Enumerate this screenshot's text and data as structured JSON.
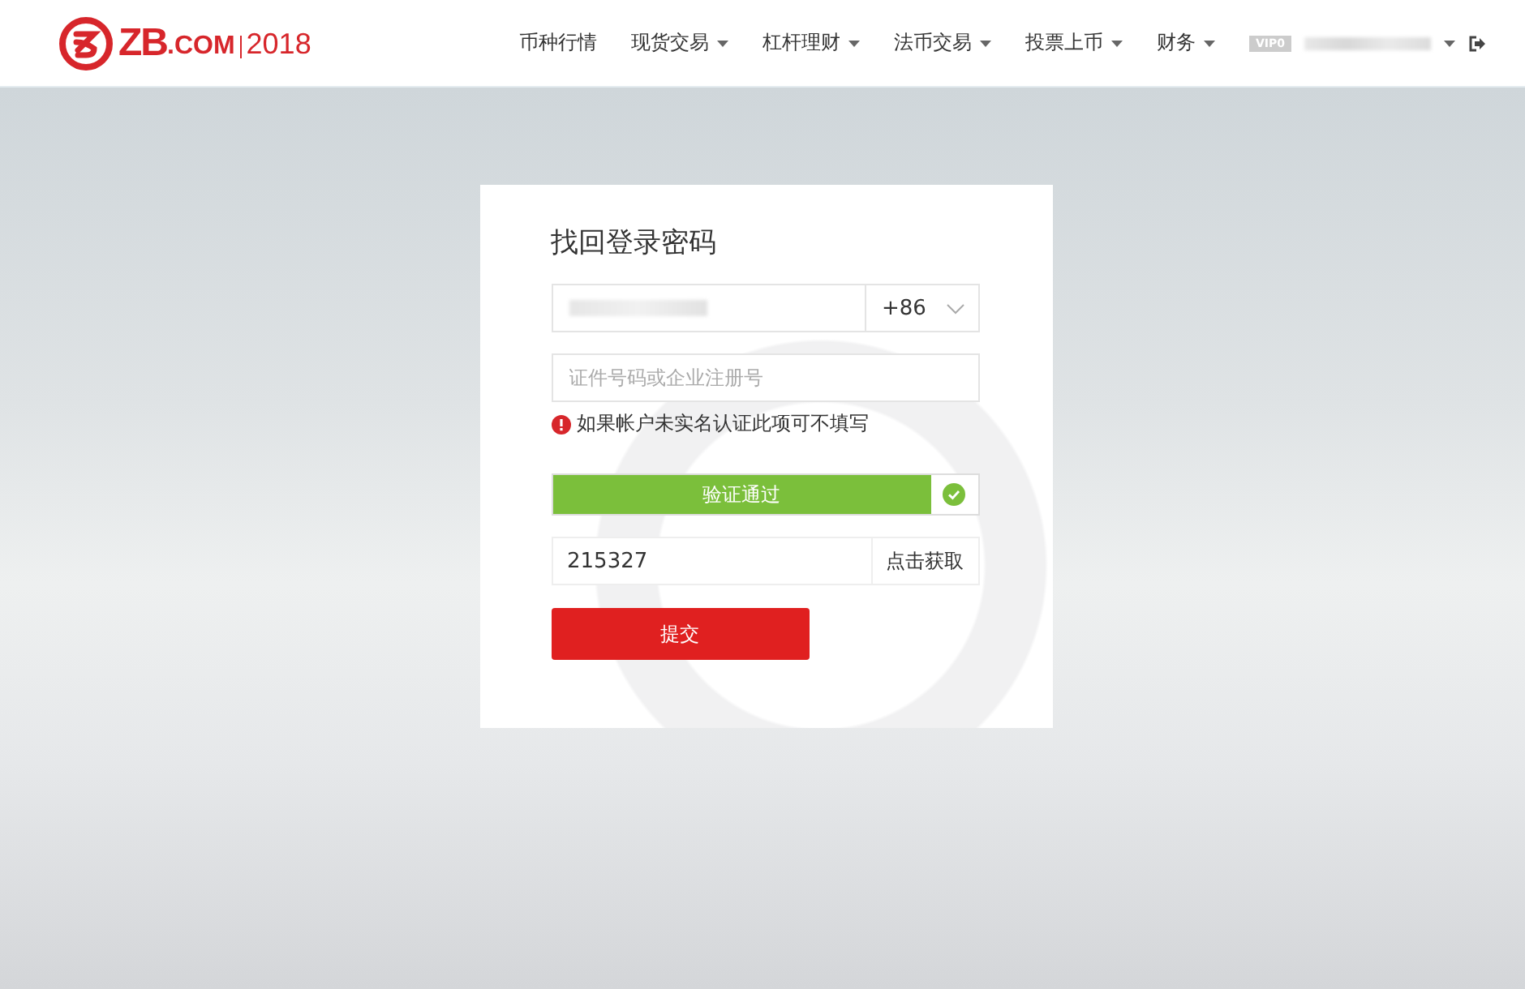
{
  "logo": {
    "brand": "ZB",
    "domain": ".COM",
    "year": "2018"
  },
  "nav": [
    {
      "label": "币种行情",
      "dropdown": false
    },
    {
      "label": "现货交易",
      "dropdown": true
    },
    {
      "label": "杠杆理财",
      "dropdown": true
    },
    {
      "label": "法币交易",
      "dropdown": true
    },
    {
      "label": "投票上币",
      "dropdown": true
    },
    {
      "label": "财务",
      "dropdown": true
    }
  ],
  "user": {
    "vip_badge": "VIP0"
  },
  "form": {
    "title": "找回登录密码",
    "phone": {
      "country_code": "+86"
    },
    "id_field": {
      "placeholder": "证件号码或企业注册号"
    },
    "hint": "如果帐户未实名认证此项可不填写",
    "verification": {
      "label": "验证通过",
      "verified": true
    },
    "sms_code": {
      "value": "215327",
      "button": "点击获取"
    },
    "submit": "提交"
  }
}
